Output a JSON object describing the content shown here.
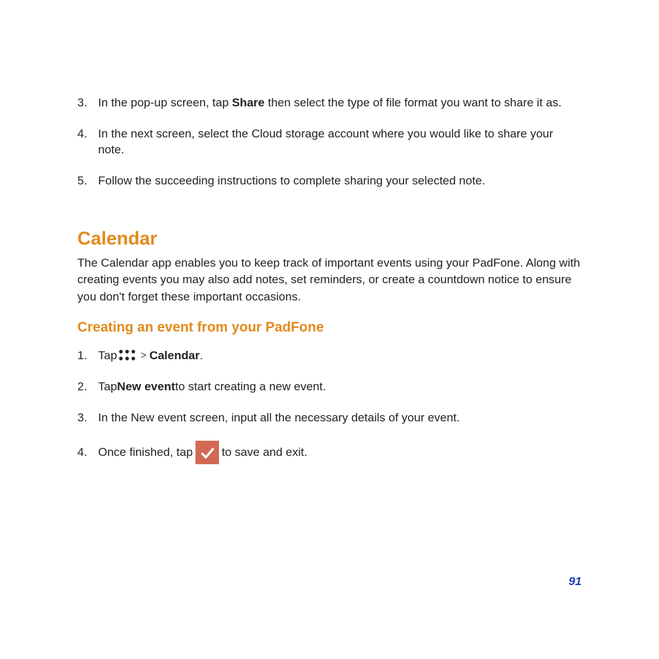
{
  "topSteps": [
    {
      "num": "3.",
      "pre": "In the pop-up screen, tap ",
      "bold": "Share",
      "post": " then select the type of file format you want to share it as."
    },
    {
      "num": "4.",
      "pre": "In the next screen, select the Cloud storage account where you would like to share your note.",
      "bold": "",
      "post": ""
    },
    {
      "num": "5.",
      "pre": "Follow the succeeding instructions to complete sharing your selected note.",
      "bold": "",
      "post": ""
    }
  ],
  "section": {
    "title": "Calendar",
    "intro": "The Calendar app enables you to keep track of important events using your PadFone. Along with creating events you may also add notes, set reminders, or create a countdown notice to ensure you don't forget these important occasions."
  },
  "subsection": {
    "title": "Creating an event from your PadFone"
  },
  "creatingSteps": {
    "s1": {
      "num": "1.",
      "tap": "Tap ",
      "gt": ">",
      "calendar": "Calendar",
      "period": "."
    },
    "s2": {
      "num": "2.",
      "pre": "Tap ",
      "bold": "New event",
      "post": " to start creating a new event."
    },
    "s3": {
      "num": "3.",
      "text": "In the New event screen, input all the necessary details of your event."
    },
    "s4": {
      "num": "4.",
      "pre": "Once finished, tap ",
      "post": " to save and exit."
    }
  },
  "pageNumber": "91"
}
